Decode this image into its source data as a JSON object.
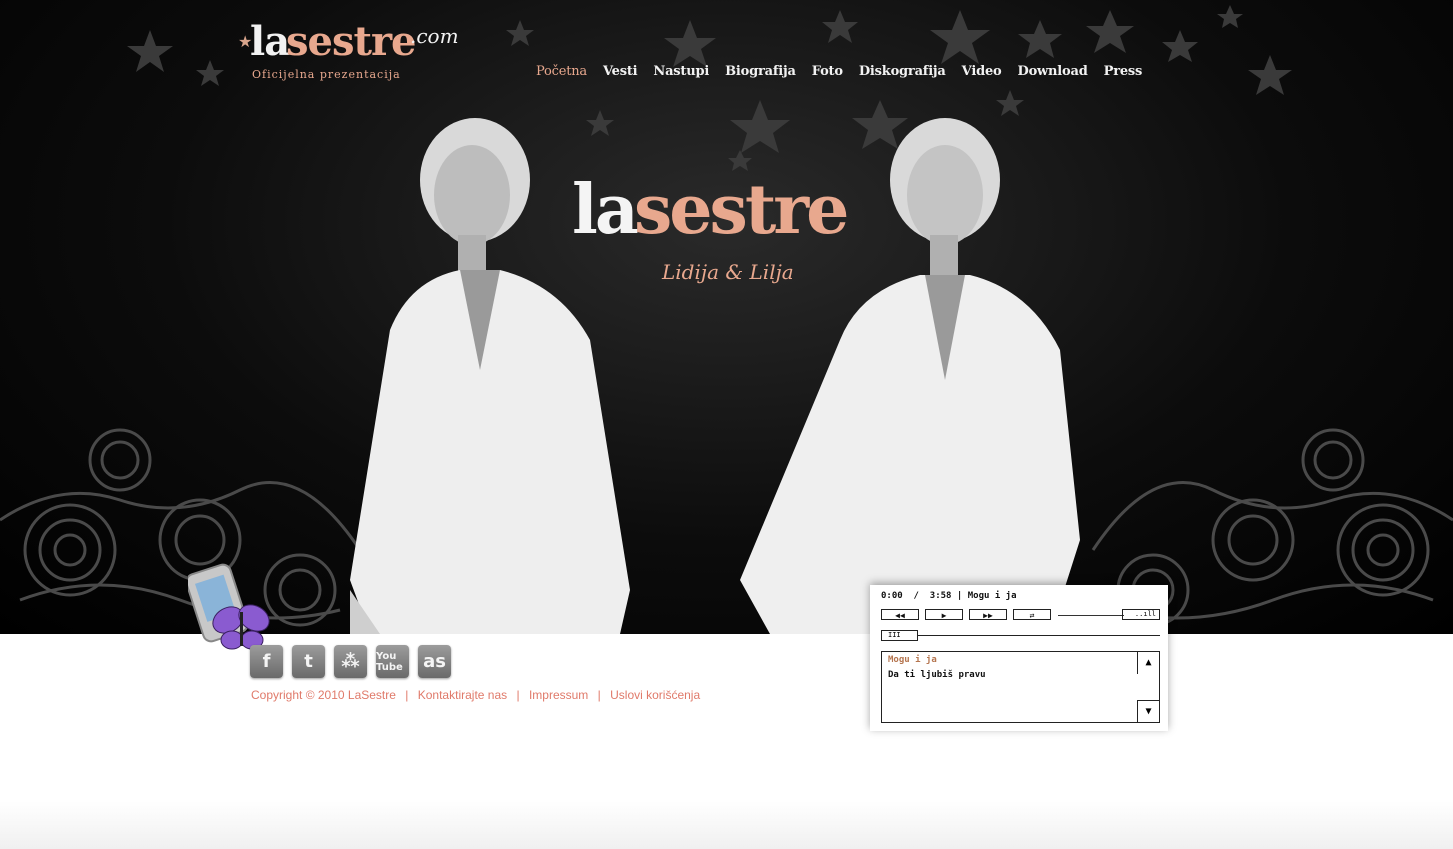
{
  "logo": {
    "la": "la",
    "sestre": "sestre",
    "com": ".com",
    "tagline": "Oficijelna prezentacija"
  },
  "nav": {
    "items": [
      "Početna",
      "Vesti",
      "Nastupi",
      "Biografija",
      "Foto",
      "Diskografija",
      "Video",
      "Download",
      "Press"
    ],
    "active": "Početna"
  },
  "hero": {
    "logo_la": "la",
    "logo_sestre": "sestre",
    "subtitle": "Lidija & Lilja"
  },
  "social": [
    {
      "name": "facebook-icon",
      "glyph": "f"
    },
    {
      "name": "twitter-icon",
      "glyph": "t"
    },
    {
      "name": "myspace-icon",
      "glyph": "⁂"
    },
    {
      "name": "youtube-icon",
      "glyph": "You Tube"
    },
    {
      "name": "lastfm-icon",
      "glyph": "as"
    }
  ],
  "footer": {
    "copyright": "Copyright © 2010 LaSestre",
    "contact": "Kontaktirajte nas",
    "impressum": "Impressum",
    "terms": "Uslovi korišćenja",
    "separator": "|"
  },
  "player": {
    "current_time": "0:00",
    "separator": "/",
    "total_time": "3:58",
    "now_playing": "Mogu i ja",
    "buttons": {
      "rewind": "◀◀",
      "play": "▶",
      "forward": "▶▶",
      "repeat": "⇄"
    },
    "volume_glyph": "..ıll",
    "progress_glyph": "III",
    "playlist": [
      "Mogu i ja",
      "Da ti ljubiš pravu"
    ],
    "scroll_up": "▲",
    "scroll_down": "▼"
  },
  "colors": {
    "accent": "#e8a88e",
    "footer_link": "#e07a6a",
    "background": "#000000"
  }
}
